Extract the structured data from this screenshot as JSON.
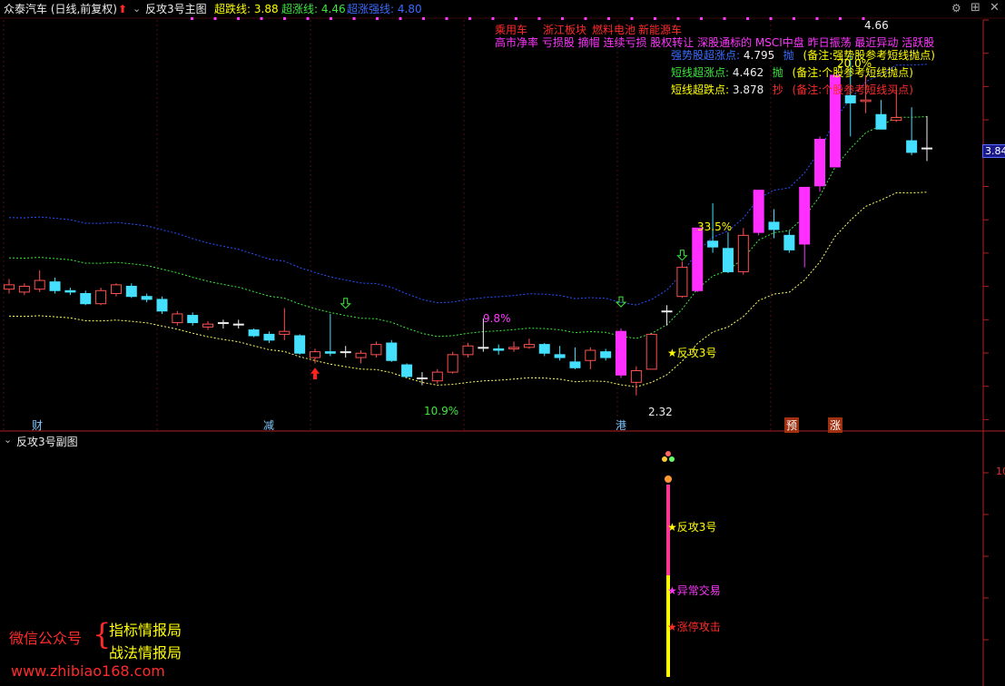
{
  "header": {
    "stock_title": "众泰汽车 (日线,前复权)",
    "indicator_name": "反攻3号主图",
    "lines": [
      {
        "label": "超跌线:",
        "value": "3.88",
        "color": "#ffff00"
      },
      {
        "label": "超涨线:",
        "value": "4.46",
        "color": "#3fe63f"
      },
      {
        "label": "超涨强线:",
        "value": "4.80",
        "color": "#3a6cff"
      }
    ]
  },
  "concepts": {
    "line1": [
      "乘用车",
      "浙江板块",
      "燃料电池",
      "新能源车"
    ],
    "line2": "高市净率 亏损股 摘帽 连续亏损 股权转让 深股通标的 MSCI中盘 昨日振荡 最近异动 活跃股"
  },
  "pivot_table": [
    {
      "name": "强势股超涨点:",
      "value": "4.795",
      "action": "抛",
      "note": "(备注:强势股参考短线抛点)",
      "color": "#3a6cff"
    },
    {
      "name": "短线超涨点:",
      "value": "4.462",
      "action": "抛",
      "note": "(备注:个股参考短线抛点)",
      "color": "#3fe63f"
    },
    {
      "name": "短线超跌点:",
      "value": "3.878",
      "action": "抄",
      "note": "(备注:个股参考短线买点)",
      "color": "#ff2b2b"
    }
  ],
  "price_axis": {
    "current_price_tag": "3.84"
  },
  "main_annotations": {
    "high_label": "4.66",
    "low_label": "2.32",
    "pct_high": "33.5%",
    "pct_mid": "9.8%",
    "pct_low": "10.9%",
    "pct_top": "20.0%",
    "signal_text": "★反攻3号"
  },
  "news_markers": [
    "财",
    "减",
    "港",
    "预",
    "涨"
  ],
  "sub_panel": {
    "title": "反攻3号副图",
    "labels": [
      "★反攻3号",
      "★异常交易",
      "★涨停攻击"
    ],
    "axis_tick": "10"
  },
  "watermark": {
    "wechat": "微信公众号",
    "brace": "{",
    "name1": "指标情报局",
    "name2": "战法情报局",
    "url": "www.zhibiao168.com"
  },
  "chart_data": {
    "type": "candlestick",
    "series_names": [
      "超跌线",
      "超涨线",
      "超涨强线"
    ],
    "ylim": [
      2.2,
      4.9
    ],
    "candles": [
      {
        "o": 3.05,
        "c": 3.08,
        "h": 3.12,
        "l": 3.02
      },
      {
        "o": 3.03,
        "c": 3.07,
        "h": 3.09,
        "l": 3.01
      },
      {
        "o": 3.05,
        "c": 3.11,
        "h": 3.18,
        "l": 3.03
      },
      {
        "o": 3.1,
        "c": 3.04,
        "h": 3.13,
        "l": 3.02
      },
      {
        "o": 3.04,
        "c": 3.03,
        "h": 3.06,
        "l": 3.01
      },
      {
        "o": 3.02,
        "c": 2.95,
        "h": 3.04,
        "l": 2.94
      },
      {
        "o": 2.95,
        "c": 3.04,
        "h": 3.06,
        "l": 2.94
      },
      {
        "o": 3.02,
        "c": 3.08,
        "h": 3.09,
        "l": 3.0
      },
      {
        "o": 3.07,
        "c": 3.0,
        "h": 3.09,
        "l": 2.99
      },
      {
        "o": 3.0,
        "c": 2.98,
        "h": 3.02,
        "l": 2.96
      },
      {
        "o": 2.98,
        "c": 2.9,
        "h": 3.0,
        "l": 2.88
      },
      {
        "o": 2.82,
        "c": 2.88,
        "h": 2.9,
        "l": 2.8
      },
      {
        "o": 2.87,
        "c": 2.82,
        "h": 2.89,
        "l": 2.8
      },
      {
        "o": 2.79,
        "c": 2.81,
        "h": 2.83,
        "l": 2.77
      },
      {
        "o": 2.82,
        "c": 2.82,
        "h": 2.84,
        "l": 2.78
      },
      {
        "o": 2.81,
        "c": 2.81,
        "h": 2.84,
        "l": 2.78
      },
      {
        "o": 2.77,
        "c": 2.73,
        "h": 2.78,
        "l": 2.72
      },
      {
        "o": 2.74,
        "c": 2.7,
        "h": 2.76,
        "l": 2.68
      },
      {
        "o": 2.74,
        "c": 2.76,
        "h": 2.92,
        "l": 2.7
      },
      {
        "o": 2.73,
        "c": 2.61,
        "h": 2.74,
        "l": 2.6
      },
      {
        "o": 2.58,
        "c": 2.62,
        "h": 2.64,
        "l": 2.54
      },
      {
        "o": 2.62,
        "c": 2.61,
        "h": 2.88,
        "l": 2.59
      },
      {
        "o": 2.62,
        "c": 2.62,
        "h": 2.66,
        "l": 2.58
      },
      {
        "o": 2.58,
        "c": 2.61,
        "h": 2.63,
        "l": 2.54
      },
      {
        "o": 2.6,
        "c": 2.67,
        "h": 2.69,
        "l": 2.58
      },
      {
        "o": 2.68,
        "c": 2.56,
        "h": 2.7,
        "l": 2.55
      },
      {
        "o": 2.53,
        "c": 2.45,
        "h": 2.54,
        "l": 2.44
      },
      {
        "o": 2.44,
        "c": 2.44,
        "h": 2.48,
        "l": 2.39
      },
      {
        "o": 2.42,
        "c": 2.48,
        "h": 2.5,
        "l": 2.4
      },
      {
        "o": 2.48,
        "c": 2.6,
        "h": 2.62,
        "l": 2.47
      },
      {
        "o": 2.6,
        "c": 2.66,
        "h": 2.68,
        "l": 2.58
      },
      {
        "o": 2.65,
        "c": 2.65,
        "h": 2.85,
        "l": 2.62
      },
      {
        "o": 2.64,
        "c": 2.63,
        "h": 2.67,
        "l": 2.6
      },
      {
        "o": 2.64,
        "c": 2.65,
        "h": 2.69,
        "l": 2.62
      },
      {
        "o": 2.65,
        "c": 2.67,
        "h": 2.71,
        "l": 2.64
      },
      {
        "o": 2.67,
        "c": 2.61,
        "h": 2.68,
        "l": 2.59
      },
      {
        "o": 2.6,
        "c": 2.58,
        "h": 2.66,
        "l": 2.56
      },
      {
        "o": 2.55,
        "c": 2.51,
        "h": 2.65,
        "l": 2.5
      },
      {
        "o": 2.56,
        "c": 2.63,
        "h": 2.65,
        "l": 2.5
      },
      {
        "o": 2.62,
        "c": 2.58,
        "h": 2.64,
        "l": 2.56
      },
      {
        "o": 2.76,
        "c": 2.46,
        "h": 2.78,
        "l": 2.44
      },
      {
        "o": 2.41,
        "c": 2.49,
        "h": 2.52,
        "l": 2.32
      },
      {
        "o": 2.5,
        "c": 2.74,
        "h": 2.74,
        "l": 2.5
      },
      {
        "o": 2.9,
        "c": 2.9,
        "h": 2.94,
        "l": 2.8
      },
      {
        "o": 3.0,
        "c": 3.2,
        "h": 3.24,
        "l": 2.99
      },
      {
        "o": 3.04,
        "c": 3.47,
        "h": 3.47,
        "l": 3.03
      },
      {
        "o": 3.38,
        "c": 3.34,
        "h": 3.64,
        "l": 3.3
      },
      {
        "o": 3.33,
        "c": 3.17,
        "h": 3.44,
        "l": 3.16
      },
      {
        "o": 3.17,
        "c": 3.42,
        "h": 3.47,
        "l": 3.15
      },
      {
        "o": 3.44,
        "c": 3.73,
        "h": 3.73,
        "l": 3.42
      },
      {
        "o": 3.51,
        "c": 3.46,
        "h": 3.6,
        "l": 3.4
      },
      {
        "o": 3.42,
        "c": 3.32,
        "h": 3.45,
        "l": 3.3
      },
      {
        "o": 3.36,
        "c": 3.75,
        "h": 3.75,
        "l": 3.2
      },
      {
        "o": 3.76,
        "c": 4.08,
        "h": 4.1,
        "l": 3.72
      },
      {
        "o": 3.89,
        "c": 4.52,
        "h": 4.52,
        "l": 3.89
      },
      {
        "o": 4.38,
        "c": 4.33,
        "h": 4.66,
        "l": 4.1
      },
      {
        "o": 4.34,
        "c": 4.35,
        "h": 4.52,
        "l": 4.26
      },
      {
        "o": 4.25,
        "c": 4.15,
        "h": 4.35,
        "l": 4.15
      },
      {
        "o": 4.21,
        "c": 4.23,
        "h": 4.44,
        "l": 4.2
      },
      {
        "o": 4.07,
        "c": 3.99,
        "h": 4.3,
        "l": 3.97
      },
      {
        "o": 4.02,
        "c": 4.02,
        "h": 4.24,
        "l": 3.93
      }
    ]
  }
}
